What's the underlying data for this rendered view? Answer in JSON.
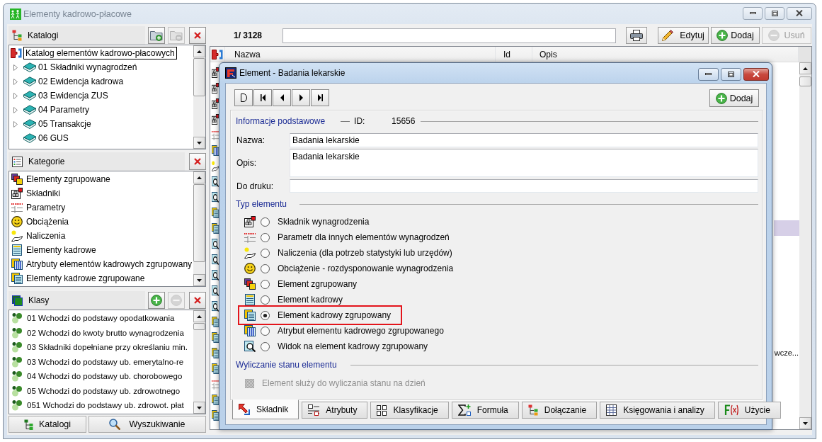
{
  "window": {
    "title": "Elementy kadrowo-płacowe"
  },
  "catalogs": {
    "title": "Katalogi",
    "buttons": [
      {
        "kind": "add_folder",
        "disabled": false
      },
      {
        "kind": "remove_folder",
        "disabled": true
      },
      {
        "kind": "close",
        "disabled": false
      }
    ],
    "tree": [
      {
        "label": "Katalog elementów kadrowo-płacowych",
        "selected": true,
        "children": [
          {
            "label": "01 Składniki wynagrodzeń",
            "selected": false,
            "expandable": true,
            "expanded": false
          },
          {
            "label": "02 Ewidencja kadrowa",
            "selected": false,
            "expandable": true,
            "expanded": false
          },
          {
            "label": "03 Ewidencja ZUS",
            "selected": false,
            "expandable": true,
            "expanded": false
          },
          {
            "label": "04 Parametry",
            "selected": false,
            "expandable": true,
            "expanded": false
          },
          {
            "label": "05 Transakcje",
            "selected": false,
            "expandable": true,
            "expanded": false
          },
          {
            "label": "06 GUS",
            "selected": false,
            "expandable": false,
            "expanded": false
          }
        ]
      }
    ]
  },
  "categories": {
    "title": "Kategorie",
    "buttons": [
      {
        "kind": "close",
        "disabled": false
      }
    ],
    "items": [
      {
        "label": "Elementy zgrupowane",
        "kind": "grouped",
        "selected": false
      },
      {
        "label": "Składniki",
        "kind": "component",
        "selected": false
      },
      {
        "label": "Parametry",
        "kind": "parameter",
        "selected": false
      },
      {
        "label": "Obciążenia",
        "kind": "charge",
        "selected": false
      },
      {
        "label": "Naliczenia",
        "kind": "accrual",
        "selected": false
      },
      {
        "label": "Elementy kadrowe",
        "kind": "hr",
        "selected": false
      },
      {
        "label": "Atrybuty elementów kadrowych zgrupowany",
        "kind": "attribute",
        "selected": false
      },
      {
        "label": "Elementy kadrowe zgrupowane",
        "kind": "hr_grouped",
        "selected": false
      }
    ]
  },
  "classes": {
    "title": "Klasy",
    "buttons": [
      {
        "kind": "add",
        "disabled": false
      },
      {
        "kind": "remove",
        "disabled": true
      },
      {
        "kind": "close",
        "disabled": false
      }
    ],
    "items": [
      {
        "label": "01 Wchodzi do podstawy opodatkowania",
        "selected": false
      },
      {
        "label": "02 Wchodzi do kwoty brutto wynagrodzenia",
        "selected": false
      },
      {
        "label": "03 Składniki dopełniane przy określaniu min.",
        "selected": false
      },
      {
        "label": "03 Wchodzi do podstawy ub. emerytalno-re",
        "selected": false
      },
      {
        "label": "04 Wchodzi do podstawy ub. chorobowego",
        "selected": false
      },
      {
        "label": "05 Wchodzi do podstawy ub. zdrowotnego",
        "selected": false
      },
      {
        "label": "051 Wchodzi do podstawy ub. zdrowot. płat",
        "selected": false
      }
    ]
  },
  "bottom_buttons": [
    {
      "label": "Katalogi",
      "kind": "catalogs"
    },
    {
      "label": "Wyszukiwanie",
      "kind": "search"
    }
  ],
  "toolbar": {
    "counter": "1/ 3128",
    "buttons": [
      {
        "label": "Edytuj",
        "kind": "edit",
        "disabled": false
      },
      {
        "label": "Dodaj",
        "kind": "add",
        "disabled": false
      },
      {
        "label": "Usuń",
        "kind": "remove",
        "disabled": true
      }
    ]
  },
  "table": {
    "columns": [
      "Nazwa",
      "Id",
      "Opis"
    ],
    "rows": [
      {
        "kind": "component",
        "selected": false
      },
      {
        "kind": "component",
        "selected": false
      },
      {
        "kind": "component",
        "selected": false
      },
      {
        "kind": "component",
        "selected": false
      },
      {
        "kind": "parameter",
        "selected": false
      },
      {
        "kind": "attribute",
        "selected": false
      },
      {
        "kind": "accrual",
        "selected": false
      },
      {
        "kind": "view",
        "selected": false
      },
      {
        "kind": "view",
        "selected": false
      },
      {
        "kind": "hr_grouped",
        "selected": false
      },
      {
        "kind": "hr_grouped",
        "selected": true
      },
      {
        "kind": "view",
        "selected": false
      },
      {
        "kind": "view",
        "selected": false
      },
      {
        "kind": "view",
        "selected": false
      },
      {
        "kind": "view",
        "selected": false
      },
      {
        "kind": "view",
        "selected": false
      },
      {
        "kind": "hr_grouped",
        "selected": false
      },
      {
        "kind": "hr_grouped",
        "selected": false
      },
      {
        "kind": "hr_grouped",
        "selected": false,
        "opis": "wcze..."
      },
      {
        "kind": "hr_grouped",
        "selected": false
      },
      {
        "kind": "parameter",
        "selected": false
      },
      {
        "kind": "hr_grouped",
        "selected": false
      },
      {
        "kind": "hr_grouped",
        "selected": false
      }
    ]
  },
  "dialog": {
    "title": "Element - Badania lekarskie",
    "add_button": {
      "label": "Dodaj"
    },
    "basic_info": {
      "heading": "Informacje podstawowe",
      "id_label": "ID:",
      "id_value": "15656",
      "fields": [
        {
          "label": "Nazwa:",
          "kind": "line",
          "value": "Badania lekarskie"
        },
        {
          "label": "Opis:",
          "kind": "multiline",
          "value": "Badania lekarskie"
        },
        {
          "label": "Do druku:",
          "kind": "line"
        }
      ]
    },
    "element_type": {
      "heading": "Typ elementu",
      "options": [
        {
          "label": "Składnik wynagrodzenia",
          "kind": "component",
          "selected": false,
          "highlighted": false
        },
        {
          "label": "Parametr dla innych elementów wynagrodzeń",
          "kind": "parameter",
          "selected": false,
          "highlighted": false
        },
        {
          "label": "Naliczenia (dla potrzeb statystyki lub urzędów)",
          "kind": "accrual",
          "selected": false,
          "highlighted": false
        },
        {
          "label": "Obciążenie - rozdysponowanie wynagrodzenia",
          "kind": "charge",
          "selected": false,
          "highlighted": false
        },
        {
          "label": "Element zgrupowany",
          "kind": "grouped",
          "selected": false,
          "highlighted": false
        },
        {
          "label": "Element kadrowy",
          "kind": "hr",
          "selected": false,
          "highlighted": false
        },
        {
          "label": "Element kadrowy zgrupowany",
          "kind": "hr_grouped",
          "selected": true,
          "highlighted": true
        },
        {
          "label": "Atrybut elementu kadrowego zgrupowanego",
          "kind": "attribute",
          "selected": false,
          "highlighted": false
        },
        {
          "label": "Widok na element kadrowy zgrupowany",
          "kind": "view",
          "selected": false,
          "highlighted": false
        }
      ]
    },
    "calculation": {
      "heading": "Wyliczanie stanu elementu",
      "checkbox": {
        "label": "Element służy do wyliczania stanu na dzień",
        "checked": false,
        "disabled": true
      }
    },
    "tabs": [
      {
        "label": "Składnik",
        "kind": "component",
        "selected": true
      },
      {
        "label": "Atrybuty",
        "kind": "attributes",
        "selected": false
      },
      {
        "label": "Klasyfikacje",
        "kind": "classification",
        "selected": false
      },
      {
        "label": "Formuła",
        "kind": "formula",
        "selected": false
      },
      {
        "label": "Dołączanie",
        "kind": "attachment",
        "selected": false
      },
      {
        "label": "Księgowania i analizy",
        "kind": "accounting",
        "selected": false
      },
      {
        "label": "Użycie",
        "kind": "usage",
        "selected": false
      }
    ]
  }
}
